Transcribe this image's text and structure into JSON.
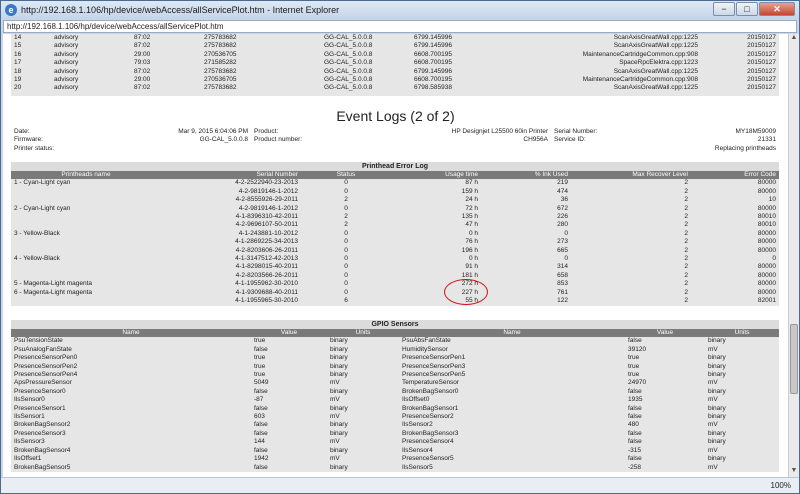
{
  "window": {
    "title": "http://192.168.1.106/hp/device/webAccess/allServicePlot.htm - Internet Explorer",
    "url": "http://192.168.1.106/hp/device/webAccess/allServicePlot.htm",
    "buttons": {
      "minimize": "−",
      "maximize": "□",
      "close": "✕"
    }
  },
  "top_table": [
    [
      "14",
      "advisory",
      "87:02",
      "275783682",
      "GG-CAL_5.0.0.8",
      "6799.145996",
      "ScanAxisGreatWall.cpp:1225",
      "20150127"
    ],
    [
      "15",
      "advisory",
      "87:02",
      "275783682",
      "GG-CAL_5.0.0.8",
      "6799.145996",
      "ScanAxisGreatWall.cpp:1225",
      "20150127"
    ],
    [
      "16",
      "advisory",
      "29:00",
      "270536705",
      "GG-CAL_5.0.0.8",
      "6608.700195",
      "MaintenanceCartridgeCommon.cpp:908",
      "20150127"
    ],
    [
      "17",
      "advisory",
      "79:03",
      "271585282",
      "GG-CAL_5.0.0.8",
      "6608.700195",
      "SpaceRpcElektra.cpp:1223",
      "20150127"
    ],
    [
      "18",
      "advisory",
      "87:02",
      "275783682",
      "GG-CAL_5.0.0.8",
      "6799.145996",
      "ScanAxisGreatWall.cpp:1225",
      "20150127"
    ],
    [
      "19",
      "advisory",
      "29:00",
      "270536705",
      "GG-CAL_5.0.0.8",
      "6608.700195",
      "MaintenanceCartridgeCommon.cpp:908",
      "20150127"
    ],
    [
      "20",
      "advisory",
      "87:02",
      "275783682",
      "GG-CAL_5.0.0.8",
      "6798.585938",
      "ScanAxisGreatWall.cpp:1225",
      "20150127"
    ]
  ],
  "event_logs": {
    "title": "Event Logs (2 of 2)",
    "info": {
      "date_label": "Date:",
      "date": "Mar 9, 2015 6:04:06 PM",
      "product_label": "Product:",
      "product": "HP Designjet L25500 60in Printer",
      "serial_label": "Serial Number:",
      "serial": "MY18M59009",
      "firmware_label": "Firmware:",
      "firmware": "GG-CAL_5.0.0.8",
      "product_number_label": "Product number:",
      "product_number": "CH956A",
      "service_id_label": "Service ID:",
      "service_id": "21331",
      "printer_status_label": "Printer status:",
      "printer_status": "Replacing printheads"
    }
  },
  "printhead_log": {
    "banner": "Printhead Error Log",
    "headers": [
      "Printheads name",
      "Serial Number",
      "Status",
      "Usage time",
      "% Ink Used",
      "Max Recover Level",
      "Error Code"
    ],
    "rows": [
      [
        "1 - Cyan-Light cyan",
        "4-2-2522940-23-2013",
        "0",
        "87 h",
        "219",
        "2",
        "80000"
      ],
      [
        "",
        "4-2-9819146-1-2012",
        "0",
        "159 h",
        "474",
        "2",
        "80000"
      ],
      [
        "",
        "4-2-8555926-29-2011",
        "2",
        "24 h",
        "36",
        "2",
        "10"
      ],
      [
        "2 - Cyan-Light cyan",
        "4-2-9819146-1-2012",
        "0",
        "72 h",
        "672",
        "2",
        "80000"
      ],
      [
        "",
        "4-1-8396310-42-2011",
        "2",
        "135 h",
        "226",
        "2",
        "80010"
      ],
      [
        "",
        "4-2-9696107-50-2011",
        "2",
        "47 h",
        "280",
        "2",
        "80010"
      ],
      [
        "3 - Yellow-Black",
        "4-1-243881-10-2012",
        "0",
        "0 h",
        "0",
        "2",
        "80000"
      ],
      [
        "",
        "4-1-2869225-34-2013",
        "0",
        "76 h",
        "273",
        "2",
        "80000"
      ],
      [
        "",
        "4-2-8203606-26-2011",
        "0",
        "196 h",
        "665",
        "2",
        "80000"
      ],
      [
        "4 - Yellow-Black",
        "4-1-3147512-42-2013",
        "0",
        "0 h",
        "0",
        "2",
        "0"
      ],
      [
        "",
        "4-1-8298015-40-2011",
        "0",
        "91 h",
        "314",
        "2",
        "80000"
      ],
      [
        "",
        "4-2-8203566-26-2011",
        "0",
        "181 h",
        "658",
        "2",
        "80000"
      ],
      [
        "5 - Magenta-Light magenta",
        "4-1-1955962-30-2010",
        "0",
        "272 h",
        "853",
        "2",
        "80000"
      ],
      [
        "6 - Magenta-Light magenta",
        "4-1-9309688-40-2011",
        "0",
        "227 h",
        "761",
        "2",
        "80000"
      ],
      [
        "",
        "4-1-1955965-30-2010",
        "6",
        "55 h",
        "122",
        "2",
        "82001"
      ]
    ]
  },
  "gpio": {
    "banner": "GPIO Sensors",
    "headers": [
      "Name",
      "Value",
      "Units",
      "Name",
      "Value",
      "Units"
    ],
    "rows": [
      [
        "PsuTensionState",
        "true",
        "binary",
        "PsuAbsFanState",
        "false",
        "binary"
      ],
      [
        "PsuAnalogFanState",
        "false",
        "binary",
        "HumiditySensor",
        "39120",
        "mV"
      ],
      [
        "PresenceSensorPen0",
        "true",
        "binary",
        "PresenceSensorPen1",
        "true",
        "binary"
      ],
      [
        "PresenceSensorPen2",
        "true",
        "binary",
        "PresenceSensorPen3",
        "true",
        "binary"
      ],
      [
        "PresenceSensorPen4",
        "true",
        "binary",
        "PresenceSensorPen5",
        "true",
        "binary"
      ],
      [
        "ApsPressureSensor",
        "5049",
        "mV",
        "TemperatureSensor",
        "24970",
        "mV"
      ],
      [
        "PresenceSensor0",
        "false",
        "binary",
        "BrokenBagSensor0",
        "false",
        "binary"
      ],
      [
        "IlsSensor0",
        "-87",
        "mV",
        "IlsOffset0",
        "1935",
        "mV"
      ],
      [
        "PresenceSensor1",
        "false",
        "binary",
        "BrokenBagSensor1",
        "false",
        "binary"
      ],
      [
        "IlsSensor1",
        "603",
        "mV",
        "PresenceSensor2",
        "false",
        "binary"
      ],
      [
        "BrokenBagSensor2",
        "false",
        "binary",
        "IlsSensor2",
        "480",
        "mV"
      ],
      [
        "PresenceSensor3",
        "false",
        "binary",
        "BrokenBagSensor3",
        "false",
        "binary"
      ],
      [
        "IlsSensor3",
        "144",
        "mV",
        "PresenceSensor4",
        "false",
        "binary"
      ],
      [
        "BrokenBagSensor4",
        "false",
        "binary",
        "IlsSensor4",
        "-315",
        "mV"
      ],
      [
        "IlsOffset1",
        "1942",
        "mV",
        "PresenceSensor5",
        "false",
        "binary"
      ],
      [
        "BrokenBagSensor5",
        "false",
        "binary",
        "IlsSensor5",
        "-258",
        "mV"
      ]
    ]
  },
  "statusbar": {
    "zoom": "100%"
  },
  "colors": {
    "annotation": "#d01010",
    "header_bg": "#7a7a7a"
  }
}
